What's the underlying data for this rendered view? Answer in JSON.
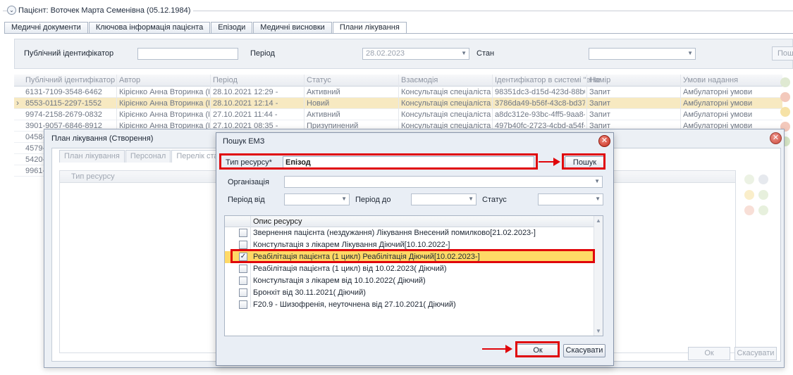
{
  "patient_header": {
    "title": "Пацієнт: Воточек Марта Семенівна (05.12.1984)"
  },
  "tabs": [
    {
      "label": "Медичні документи"
    },
    {
      "label": "Ключова інформація пацієнта"
    },
    {
      "label": "Епізоди"
    },
    {
      "label": "Медичні висновки"
    },
    {
      "label": "Плани лікування"
    }
  ],
  "filter": {
    "public_id_label": "Публічний ідентифікатор",
    "public_id_value": "",
    "period_label": "Період",
    "period_value": "28.02.2023",
    "status_label": "Стан",
    "status_value": "",
    "search_label": "Пош"
  },
  "grid": {
    "columns": [
      "Публічний ідентифікатор",
      "Автор",
      "Період",
      "Статус",
      "Взаємодія",
      "Ідентифікатор в системі \"еНе",
      "Намір",
      "Умови надання"
    ],
    "rows": [
      [
        "6131-7109-3548-6462",
        "Кірієнко Анна Вторинка (П...",
        "28.10.2021 12:29 -",
        "Активний",
        "Консультація спеціаліста С...",
        "98351dc3-d15d-423d-88b0-...",
        "Запит",
        "Амбулаторні умови"
      ],
      [
        "8553-0115-2297-1552",
        "Кірієнко Анна Вторинка (П...",
        "28.10.2021 12:14 -",
        "Новий",
        "Консультація спеціаліста С...",
        "3786da49-b56f-43c8-bd37-...",
        "Запит",
        "Амбулаторні умови"
      ],
      [
        "9974-2158-2679-0832",
        "Кірієнко Анна Вторинка (П...",
        "27.10.2021 11:44 -",
        "Активний",
        "Консультація спеціаліста С...",
        "a8dc312e-93bc-4ff5-9aa8-e...",
        "Запит",
        "Амбулаторні умови"
      ],
      [
        "3901-9057-6846-8912",
        "Кірієнко Анна Вторинка (П...",
        "27.10.2021 08:35 -",
        "Призупинений",
        "Консультація спеціаліста С...",
        "497b40fc-2723-4cbd-a54f-b...",
        "Запит",
        "Амбулаторні умови"
      ],
      [
        "0458-(",
        "",
        "",
        "",
        "",
        "",
        "",
        ""
      ],
      [
        "4579-",
        "",
        "",
        "",
        "",
        "",
        "",
        ""
      ],
      [
        "5420-(",
        "",
        "",
        "",
        "",
        "",
        "",
        ""
      ],
      [
        "9961-",
        "",
        "",
        "",
        "",
        "",
        "",
        ""
      ]
    ],
    "selected_row": 1
  },
  "plan_dialog": {
    "title": "План лікування (Створення)",
    "tabs": [
      "План лікування",
      "Персонал",
      "Перелік станів та с"
    ],
    "grid_header": "Тип ресурсу",
    "ok_label": "Ок",
    "cancel_label": "Скасувати"
  },
  "emz_dialog": {
    "title": "Пошук ЕМЗ",
    "resource_type_label": "Тип ресурсу*",
    "resource_type_value": "Епізод",
    "search_button": "Пошук",
    "organization_label": "Організація",
    "organization_value": "",
    "period_from_label": "Період від",
    "period_from_value": "",
    "period_to_label": "Період до",
    "period_to_value": "",
    "status_label": "Статус",
    "status_value": "",
    "list_header": "Опис ресурсу",
    "items": [
      {
        "text": "Звернення пацієнта (нездужання) Лікування Внесений помилково[21.02.2023-]",
        "checked": false
      },
      {
        "text": "Констультація з лікарем Лікування Діючий[10.10.2022-]",
        "checked": false
      },
      {
        "text": "Реабілітація пацієнта (1 цикл) Реабілітація Діючий[10.02.2023-]",
        "checked": true
      },
      {
        "text": "Реабілітація пацієнта (1 цикл) від 10.02.2023( Діючий)",
        "checked": false
      },
      {
        "text": "Констультація з лікарем від 10.10.2022( Діючий)",
        "checked": false
      },
      {
        "text": "Бронхіт від 30.11.2021( Діючий)",
        "checked": false
      },
      {
        "text": "F20.9 - Шизофренія, неуточнена від 27.10.2021( Діючий)",
        "checked": false
      }
    ],
    "ok_label": "Ок",
    "cancel_label": "Скасувати",
    "highlight_color": "#e0060b"
  },
  "colors": {
    "selected_row": "#f7e9c1",
    "highlight_row": "#ffd966",
    "annotation_red": "#e0060b"
  }
}
